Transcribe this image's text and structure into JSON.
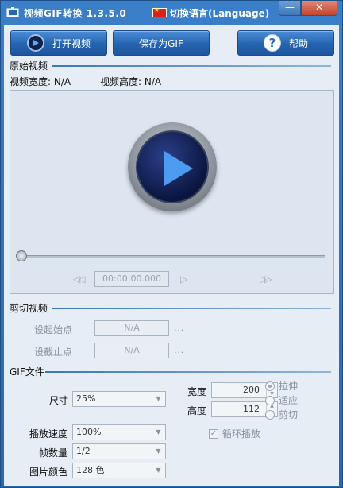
{
  "titlebar": {
    "title": "视频GIF转换 1.3.5.0",
    "language_label": "切换语言(Language)",
    "minimize_label": "—",
    "close_label": "✕"
  },
  "toolbar": {
    "open_label": "打开视频",
    "save_label": "保存为GIF",
    "help_label": "帮助"
  },
  "original": {
    "section_title": "原始视频",
    "width_label": "视频宽度: N/A",
    "height_label": "视频高度: N/A",
    "time_value": "00:00:00.000",
    "rewind_label": "◁◁",
    "play_label": "▷",
    "forward_label": "▷▷"
  },
  "cut": {
    "section_title": "剪切视频",
    "start_label": "设起始点",
    "start_value": "N/A",
    "end_label": "设截止点",
    "end_value": "N/A",
    "more_label": "..."
  },
  "gif": {
    "section_title": "GIF文件",
    "size_label": "尺寸",
    "size_value": "25%",
    "width_label": "宽度",
    "width_value": "200",
    "height_label": "高度",
    "height_value": "112",
    "mode_options": [
      "拉伸",
      "适应",
      "剪切"
    ],
    "mode_selected": "拉伸",
    "speed_label": "播放速度",
    "speed_value": "100%",
    "frames_label": "帧数量",
    "frames_value": "1/2",
    "colors_label": "图片颜色",
    "colors_value": "128 色",
    "loop_label": "循环播放",
    "loop_checked": true,
    "check_mark": "✓"
  },
  "colors": {
    "accent": "#2a68ad",
    "panel": "#e6edf5"
  },
  "icons": [
    "app-icon",
    "flag-icon",
    "play-icon",
    "help-icon",
    "rewind-icon",
    "forward-icon"
  ]
}
